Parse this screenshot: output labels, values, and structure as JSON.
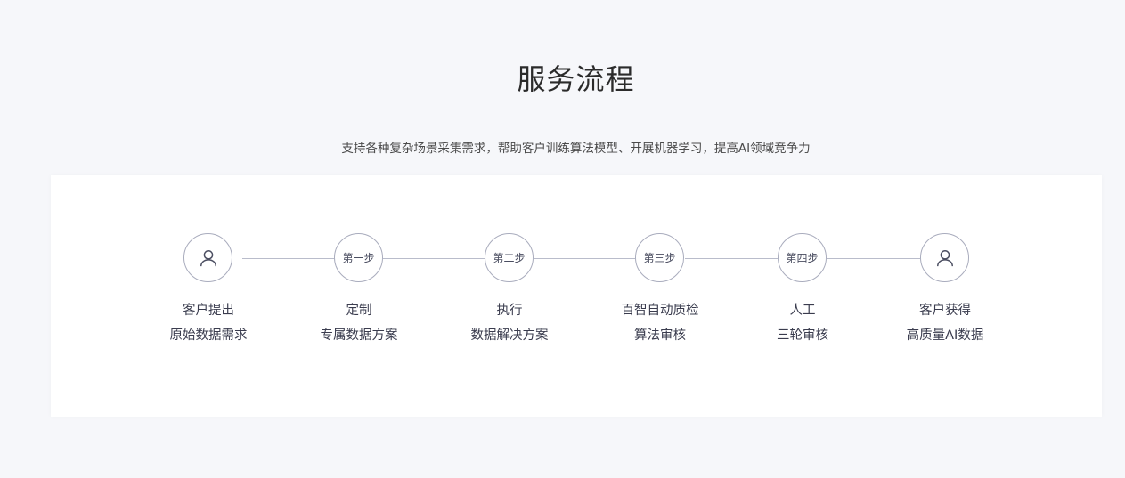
{
  "section": {
    "title": "服务流程",
    "subtitle": "支持各种复杂场景采集需求，帮助客户训练算法模型、开展机器学习，提高AI领域竞争力"
  },
  "steps": [
    {
      "icon": "user-icon",
      "badge": "",
      "line1": "客户提出",
      "line2": "原始数据需求"
    },
    {
      "icon": "",
      "badge": "第一步",
      "line1": "定制",
      "line2": "专属数据方案"
    },
    {
      "icon": "",
      "badge": "第二步",
      "line1": "执行",
      "line2": "数据解决方案"
    },
    {
      "icon": "",
      "badge": "第三步",
      "line1": "百智自动质检",
      "line2": "算法审核"
    },
    {
      "icon": "",
      "badge": "第四步",
      "line1": "人工",
      "line2": "三轮审核"
    },
    {
      "icon": "user-icon",
      "badge": "",
      "line1": "客户获得",
      "line2": "高质量AI数据"
    }
  ],
  "colors": {
    "background": "#f6f7fa",
    "card": "#ffffff",
    "connector": "#b9bccb",
    "node_border": "#a9acbd",
    "label_text": "#3a3c4e"
  }
}
